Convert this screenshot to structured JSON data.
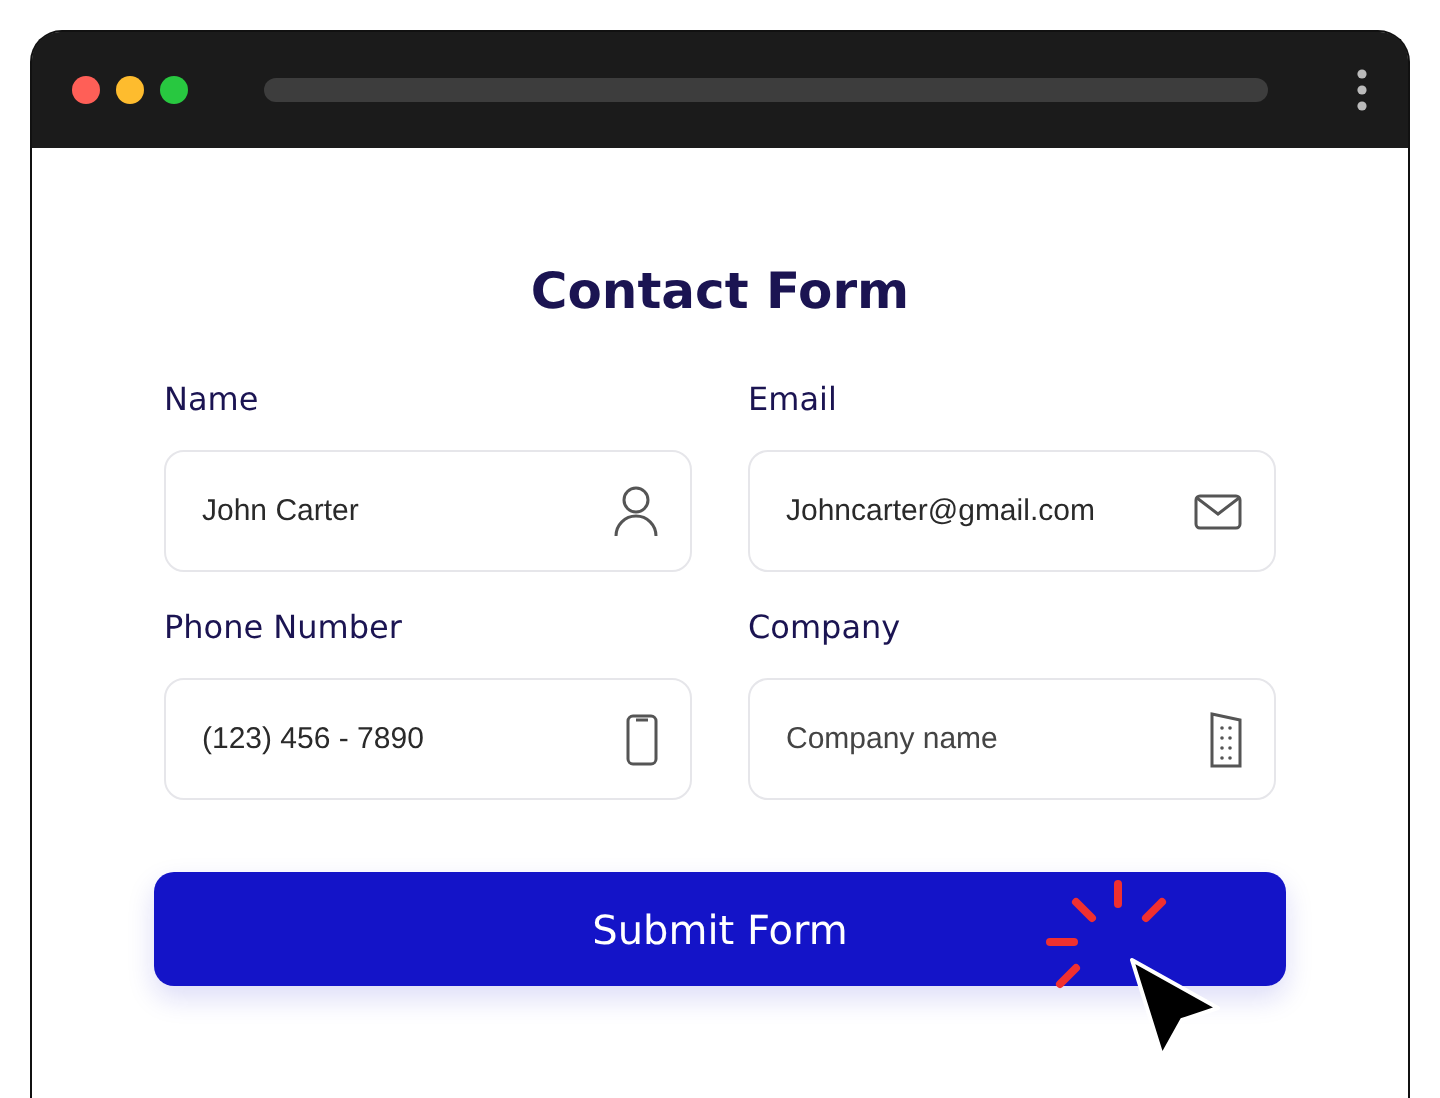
{
  "window": {
    "kind": "browser"
  },
  "form": {
    "title": "Contact Form",
    "fields": [
      {
        "label": "Name",
        "value": "John Carter",
        "kind": "person"
      },
      {
        "label": "Email",
        "value": "Johncarter@gmail.com",
        "kind": "mail"
      },
      {
        "label": "Phone Number",
        "value": "(123) 456 - 7890",
        "kind": "phone"
      },
      {
        "label": "Company",
        "placeholder": "Company name",
        "kind": "building"
      }
    ],
    "submit": "Submit Form"
  }
}
